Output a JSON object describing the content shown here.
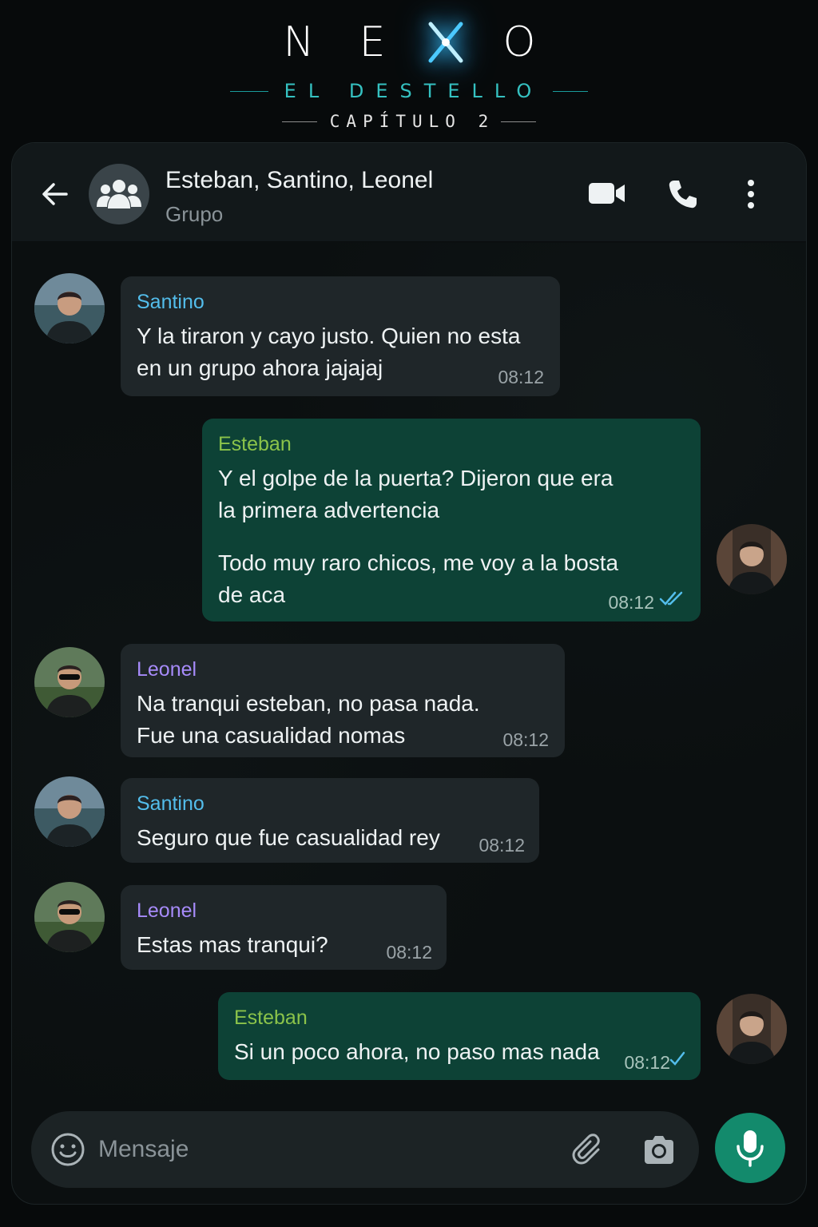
{
  "brand": {
    "letters": [
      "N",
      "E",
      "O"
    ],
    "logo_x_icon": "x-glow",
    "subtitle": "EL DESTELLO",
    "chapter": "CAPÍTULO 2"
  },
  "header": {
    "title": "Esteban, Santino, Leonel",
    "subtitle": "Grupo",
    "icons": [
      "back-arrow",
      "group-avatar",
      "video-call",
      "voice-call",
      "more-vertical"
    ]
  },
  "messages": [
    {
      "sender": "Santino",
      "direction": "in",
      "sender_color": "#53bdeb",
      "lines": [
        "Y la tiraron y cayo justo. Quien no esta",
        "en un grupo ahora jajajaj"
      ],
      "time": "08:12"
    },
    {
      "sender": "Esteban",
      "direction": "out",
      "sender_color": "#8bc34a",
      "lines": [
        "Y el golpe de la puerta? Dijeron que era",
        "la primera advertencia"
      ],
      "lines2": [
        "Todo muy raro chicos, me voy a la bosta",
        "de aca"
      ],
      "time": "08:12",
      "status": "read"
    },
    {
      "sender": "Leonel",
      "direction": "in",
      "sender_color": "#a78bfa",
      "lines": [
        "Na tranqui esteban, no pasa nada.",
        "Fue una casualidad nomas"
      ],
      "time": "08:12"
    },
    {
      "sender": "Santino",
      "direction": "in",
      "sender_color": "#53bdeb",
      "lines": [
        "Seguro que fue casualidad rey"
      ],
      "time": "08:12"
    },
    {
      "sender": "Leonel",
      "direction": "in",
      "sender_color": "#a78bfa",
      "lines": [
        "Estas mas tranqui?"
      ],
      "time": "08:12"
    },
    {
      "sender": "Esteban",
      "direction": "out",
      "sender_color": "#8bc34a",
      "lines": [
        "Si un poco ahora, no paso mas nada"
      ],
      "time": "08:12",
      "status": "read"
    }
  ],
  "input": {
    "placeholder": "Mensaje",
    "icons": [
      "emoji",
      "attach-clip",
      "camera",
      "microphone"
    ]
  },
  "colors": {
    "incoming_bubble": "#1f2629",
    "outgoing_bubble": "#0d4236",
    "mic_button": "#138a6c",
    "read_ticks": "#53bdeb"
  }
}
